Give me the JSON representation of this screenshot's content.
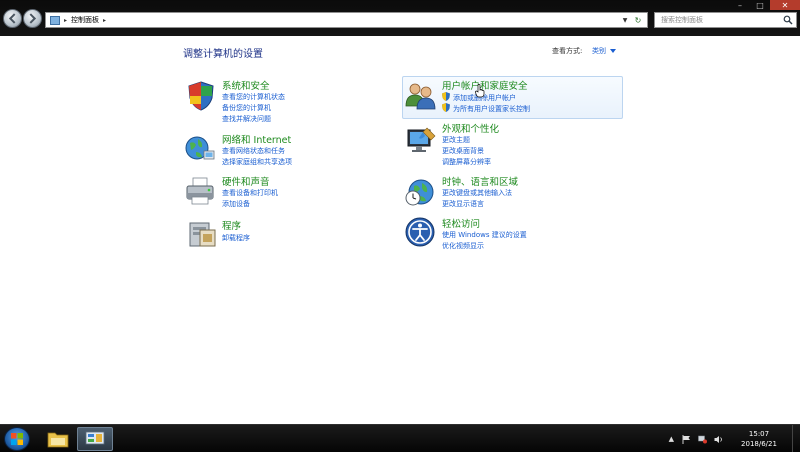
{
  "address_bar": {
    "path": "控制面板"
  },
  "search": {
    "placeholder": "搜索控制面板"
  },
  "window_controls": {
    "minimize": "–",
    "maximize": "□",
    "close": "✕"
  },
  "header": {
    "title": "调整计算机的设置",
    "view_by_label": "查看方式:",
    "view_by_value": "类别"
  },
  "categories": [
    {
      "title": "系统和安全",
      "links": [
        "查看您的计算机状态",
        "备份您的计算机",
        "查找并解决问题"
      ],
      "icon": "shield-flag-icon"
    },
    {
      "title": "网络和 Internet",
      "links": [
        "查看网络状态和任务",
        "选择家庭组和共享选项"
      ],
      "icon": "globe-network-icon"
    },
    {
      "title": "硬件和声音",
      "links": [
        "查看设备和打印机",
        "添加设备"
      ],
      "icon": "printer-icon"
    },
    {
      "title": "程序",
      "links": [
        "卸载程序"
      ],
      "icon": "programs-icon"
    },
    {
      "title": "用户帐户和家庭安全",
      "links": [
        "添加或删除用户帐户",
        "为所有用户设置家长控制"
      ],
      "icon": "users-icon",
      "hovered": true
    },
    {
      "title": "外观和个性化",
      "links": [
        "更改主题",
        "更改桌面背景",
        "调整屏幕分辨率"
      ],
      "icon": "monitor-paint-icon"
    },
    {
      "title": "时钟、语言和区域",
      "links": [
        "更改键盘或其他输入法",
        "更改显示语言"
      ],
      "icon": "clock-globe-icon"
    },
    {
      "title": "轻松访问",
      "links": [
        "使用 Windows 建议的设置",
        "优化视频显示"
      ],
      "icon": "ease-of-access-icon"
    }
  ],
  "taskbar": {
    "clock_time": "15:07",
    "clock_date": "2018/6/21",
    "tray_up": "▲"
  },
  "colors": {
    "title_green": "#1f8a1f",
    "link_blue": "#1a5ed1",
    "heading_blue": "#1e3287"
  }
}
